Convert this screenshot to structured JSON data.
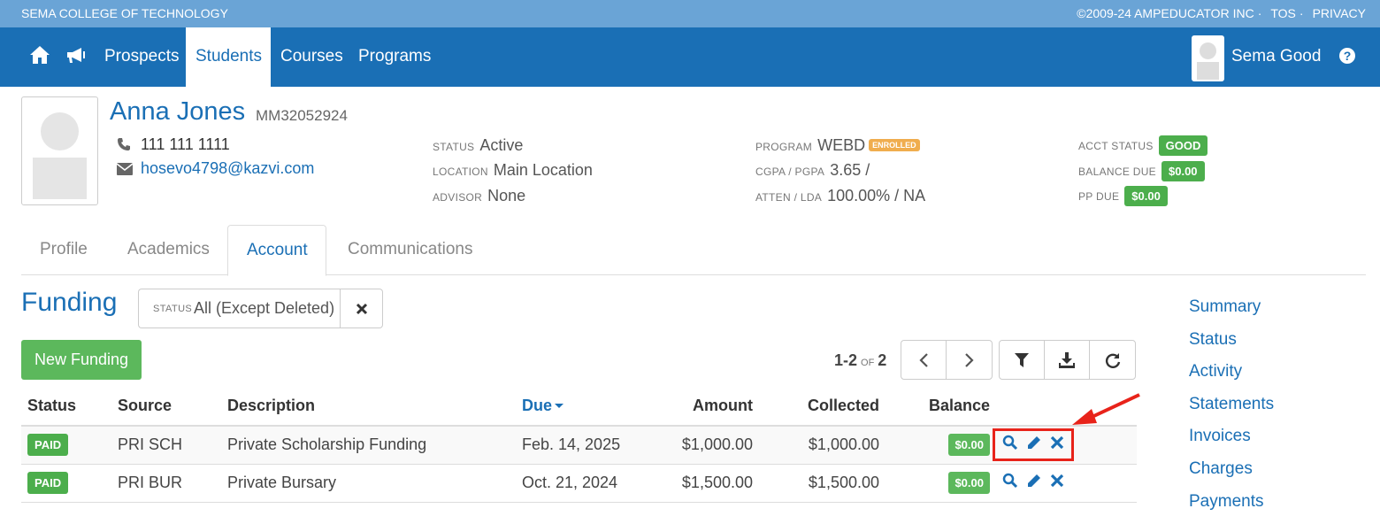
{
  "topbar": {
    "school": "SEMA COLLEGE OF TECHNOLOGY",
    "copyright": "©2009-24 AMPEDUCATOR INC",
    "sep": "·",
    "tos": "TOS",
    "privacy": "PRIVACY"
  },
  "nav": {
    "links": [
      "Prospects",
      "Students",
      "Courses",
      "Programs"
    ],
    "active": "Students",
    "user_name": "Sema Good"
  },
  "student": {
    "name": "Anna Jones",
    "id": "MM32052924",
    "phone": "111 111 1111",
    "email": "hosevo4798@kazvi.com",
    "status_label": "STATUS",
    "status": "Active",
    "location_label": "LOCATION",
    "location": "Main Location",
    "advisor_label": "ADVISOR",
    "advisor": "None",
    "program_label": "PROGRAM",
    "program": "WEBD",
    "program_badge": "ENROLLED",
    "cgpa_label": "CGPA / PGPA",
    "cgpa": "3.65 /",
    "atten_label": "ATTEN / LDA",
    "atten": "100.00% / NA",
    "acct_status_label": "ACCT STATUS",
    "acct_status": "GOOD",
    "balance_due_label": "BALANCE DUE",
    "balance_due": "$0.00",
    "pp_due_label": "PP DUE",
    "pp_due": "$0.00"
  },
  "tabs": [
    "Profile",
    "Academics",
    "Account",
    "Communications"
  ],
  "funding": {
    "title": "Funding",
    "status_filter_label": "STATUS",
    "status_filter_value": "All (Except Deleted)",
    "new_button": "New Funding",
    "pager_range": "1-2",
    "pager_of": "OF",
    "pager_total": "2"
  },
  "table": {
    "headers": [
      "Status",
      "Source",
      "Description",
      "Due",
      "Amount",
      "Collected",
      "Balance"
    ],
    "rows": [
      {
        "status": "PAID",
        "source": "PRI SCH",
        "description": "Private Scholarship Funding",
        "due": "Feb. 14, 2025",
        "amount": "$1,000.00",
        "collected": "$1,000.00",
        "balance": "$0.00"
      },
      {
        "status": "PAID",
        "source": "PRI BUR",
        "description": "Private Bursary",
        "due": "Oct. 21, 2024",
        "amount": "$1,500.00",
        "collected": "$1,500.00",
        "balance": "$0.00"
      }
    ]
  },
  "side_links": [
    "Summary",
    "Status",
    "Activity",
    "Statements",
    "Invoices",
    "Charges",
    "Payments"
  ],
  "colors": {
    "brand_blue": "#1a6fb5",
    "topbar": "#6aa4d6",
    "green": "#5cb85c",
    "highlight_red": "#e8231a"
  },
  "icons": [
    "home-icon",
    "megaphone-icon",
    "help-icon",
    "phone-icon",
    "envelope-icon",
    "times-icon",
    "chevron-left-icon",
    "chevron-right-icon",
    "filter-icon",
    "download-icon",
    "refresh-icon",
    "search-icon",
    "pencil-icon"
  ]
}
